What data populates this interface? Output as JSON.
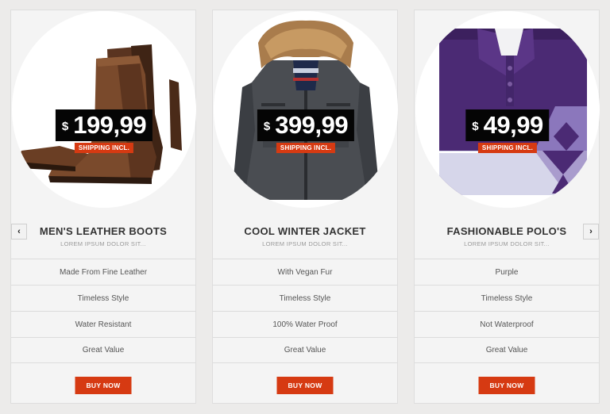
{
  "products": [
    {
      "currency": "$",
      "price": "199,99",
      "shipping": "SHIPPING INCL.",
      "title": "MEN'S LEATHER BOOTS",
      "subtitle": "LOREM IPSUM DOLOR SIT...",
      "features": [
        "Made From Fine Leather",
        "Timeless Style",
        "Water Resistant",
        "Great Value"
      ],
      "button": "BUY NOW"
    },
    {
      "currency": "$",
      "price": "399,99",
      "shipping": "SHIPPING INCL.",
      "title": "COOL WINTER JACKET",
      "subtitle": "LOREM IPSUM DOLOR SIT...",
      "features": [
        "With Vegan Fur",
        "Timeless Style",
        "100% Water Proof",
        "Great Value"
      ],
      "button": "BUY NOW"
    },
    {
      "currency": "$",
      "price": "49,99",
      "shipping": "SHIPPING INCL.",
      "title": "FASHIONABLE POLO'S",
      "subtitle": "LOREM IPSUM DOLOR SIT...",
      "features": [
        "Purple",
        "Timeless Style",
        "Not Waterproof",
        "Great Value"
      ],
      "button": "BUY NOW"
    }
  ],
  "nav": {
    "prev": "‹",
    "next": "›"
  },
  "colors": {
    "accent": "#d63a12",
    "price_bg": "#050505",
    "card_bg": "#f4f4f4"
  }
}
